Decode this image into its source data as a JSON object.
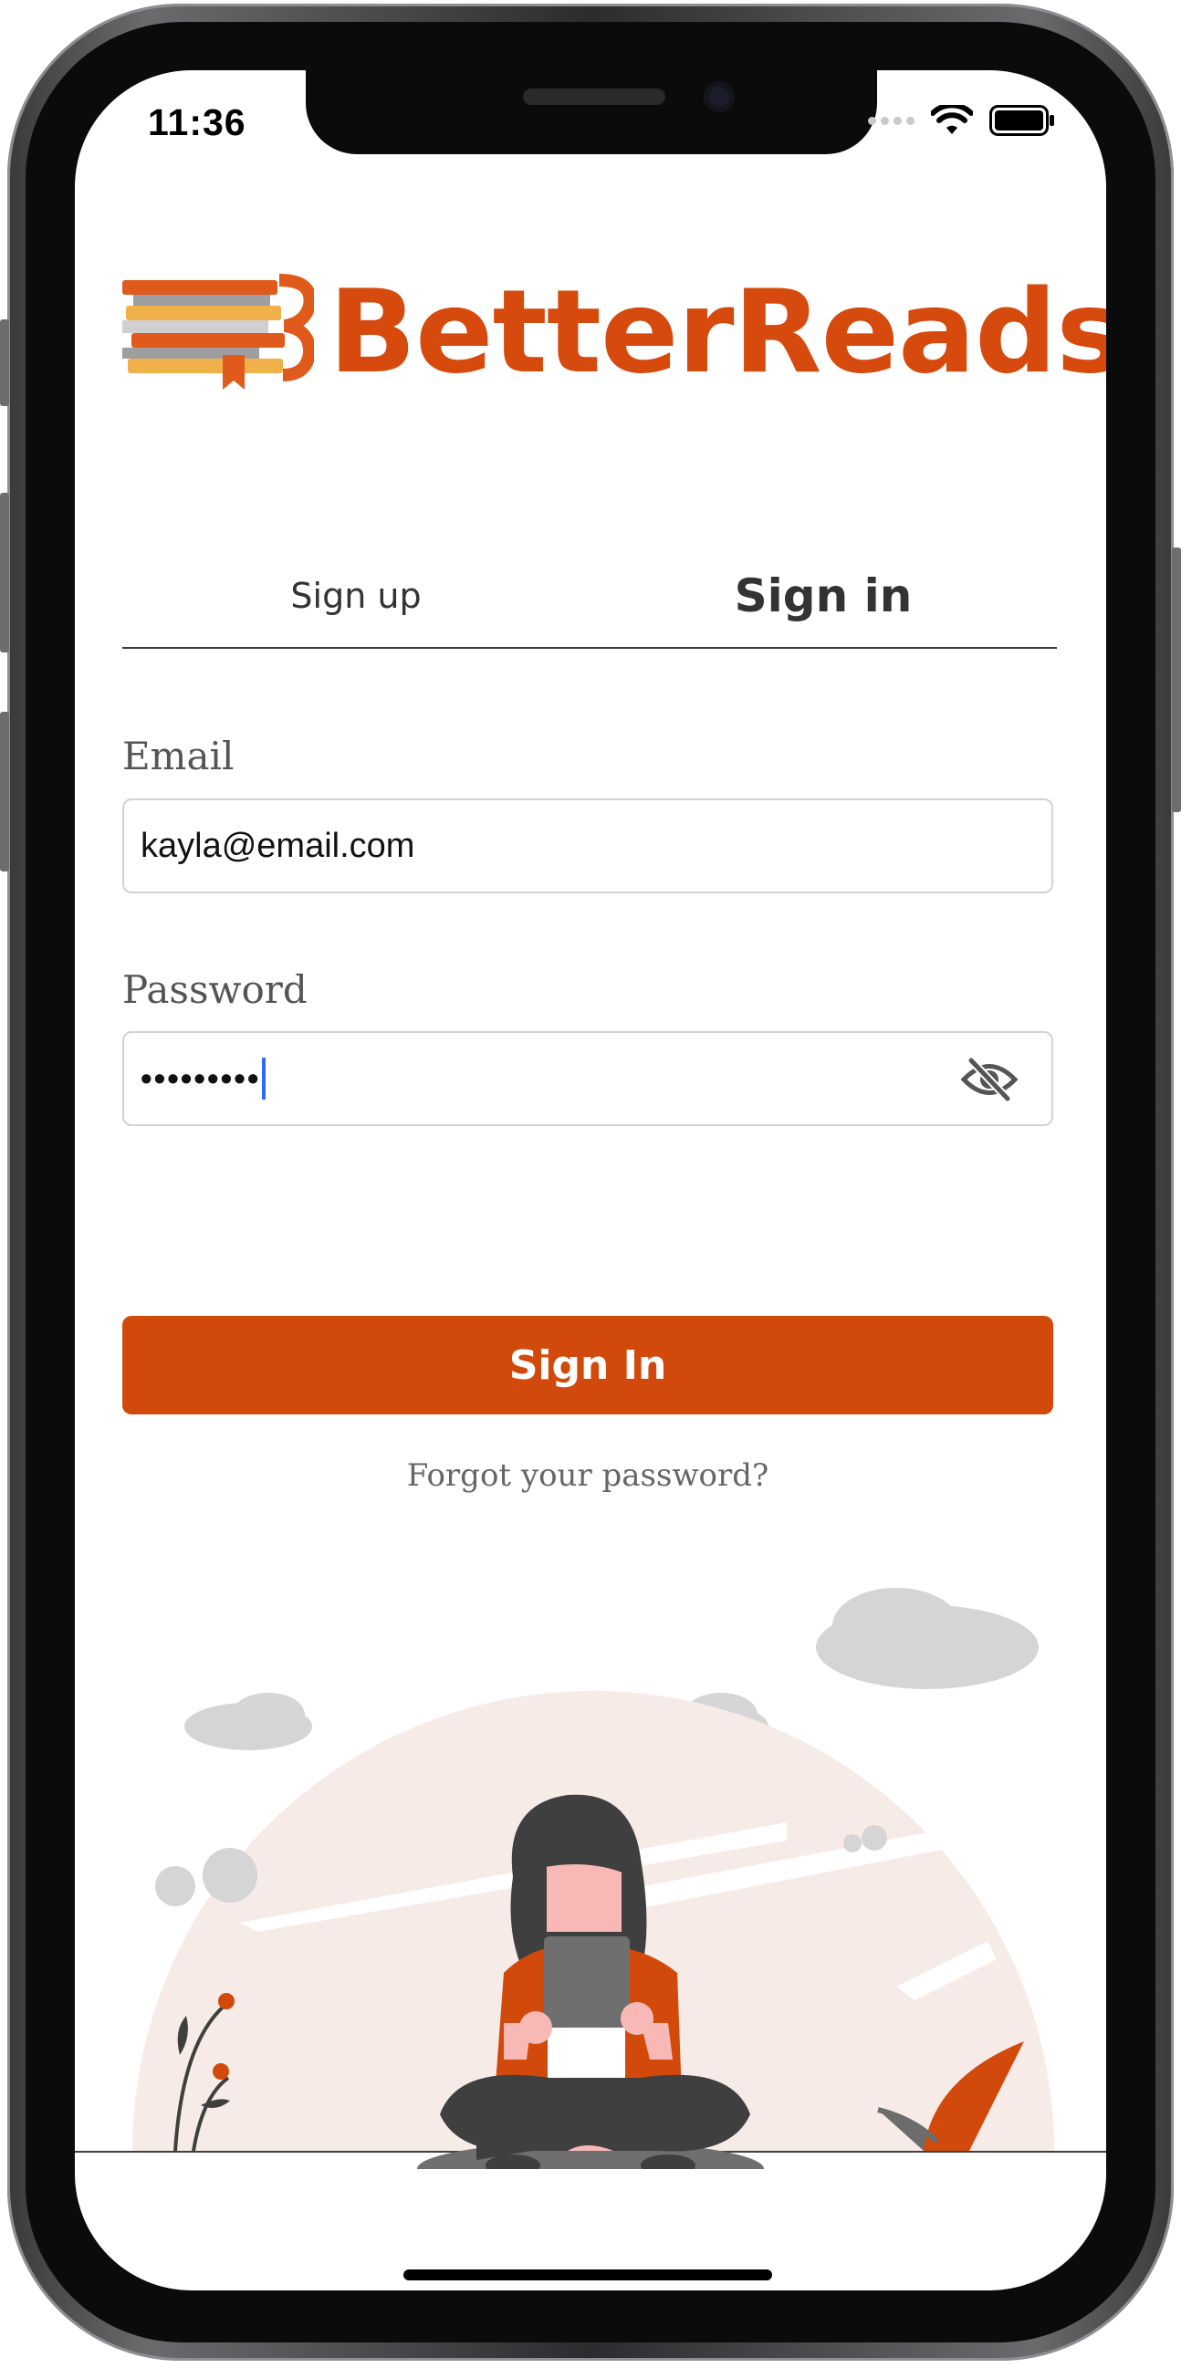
{
  "status_bar": {
    "time": "11:36",
    "wifi_icon": "wifi-icon",
    "battery_icon": "battery-icon"
  },
  "brand": {
    "name": "BetterReads",
    "color": "#d64a0d",
    "logo_icon": "books-bookmark-icon"
  },
  "tabs": [
    {
      "label": "Sign up",
      "active": false
    },
    {
      "label": "Sign in",
      "active": true
    }
  ],
  "form": {
    "email_label": "Email",
    "email_value": "kayla@email.com",
    "password_label": "Password",
    "password_value": "•••••••••",
    "toggle_icon": "eye-slash-icon"
  },
  "actions": {
    "submit_label": "Sign In",
    "forgot_label": "Forgot your password?"
  },
  "colors": {
    "accent": "#d24a0b",
    "illustration_bg": "#f6ebe7"
  }
}
